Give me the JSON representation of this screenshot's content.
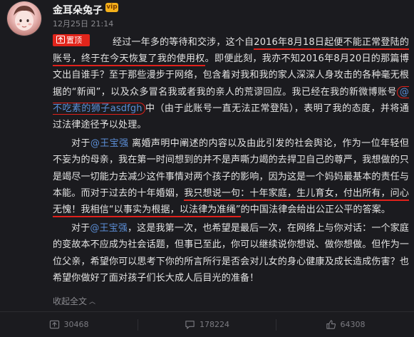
{
  "header": {
    "username": "金耳朵兔子",
    "member_badge": "vip",
    "timestamp": "12月25日 21:14"
  },
  "post": {
    "pin_label": "置顶",
    "p1_a": "经过一年多的等待和交涉，这个自",
    "p1_b": "2016年8月18日起便不能正常登陆的账号，终于在今天恢复了我的使用权",
    "p1_c": "。即便此刻，我亦不知2016年8月20日的那篇博文出自谁手？至于那些漫步于网络，包含着对我和我的家人深深人身攻击的各种毫无根据的“新闻”，以及众多冒名我或者我的亲人的荒谬回应。我已经在我的新微博账号",
    "p1_mention": "@不吃素的狮子asdfgh",
    "p1_d": "中（由于此账号一直无法正常登陆），表明了我的态度，并将通过法律途径予以处理。",
    "p2_a": "对于",
    "p2_mention": "@王宝强",
    "p2_b": " 离婚声明中阐述的内容以及由此引发的社会舆论，作为一位年轻但不妄为的母亲，我在第一时间想到的并不是声嘶力竭的去捍卫自己的尊严，我想做的只是竭尽一切能力去减少这件事情对两个孩子的影响，因为这是一个妈妈最基本的责任与本能。而对于过去的十年婚姻，",
    "p2_c": "我只想说一句：十年家庭，生儿育女，付出所有，问心无愧！我相信“以事实为根据，以法律为准绳”",
    "p2_d": "的中国法律会给出公正公平的答案。",
    "p3_a": "对于",
    "p3_mention": "@王宝强",
    "p3_b": "，这是我第一次，也希望是最后一次，在网络上与你对话：一个家庭的变故本不应成为社会话题，但事已至此，你可以继续说你想说、做你想做。但作为一位父亲，希望你可以思考下你的所言所行是否会对儿女的身心健康及成长造成伤害？也希望你做好了面对孩子们长大成人后目光的准备！",
    "collapse_label": "收起全文"
  },
  "actions": {
    "repost_count": "30468",
    "comment_count": "178224",
    "like_count": "64308"
  },
  "colors": {
    "background": "#1b1b1f",
    "mention": "#5b8ed6",
    "highlight": "#e0211b",
    "pin": "#e1251b"
  }
}
